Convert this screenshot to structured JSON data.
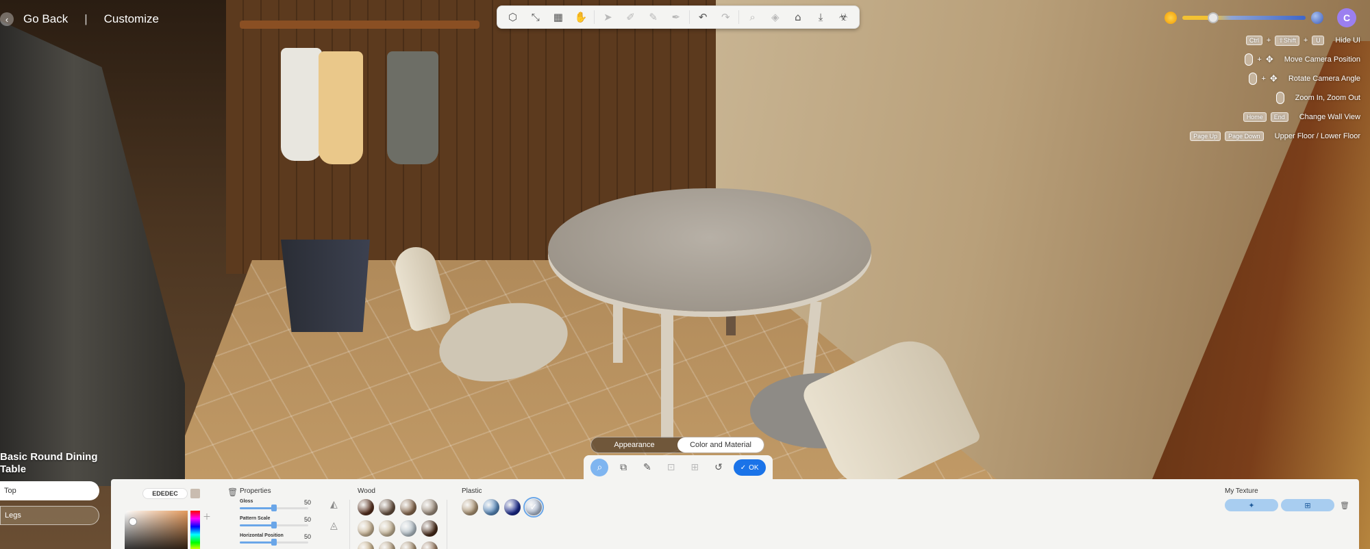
{
  "nav": {
    "back_label": "Go Back",
    "separator": "|",
    "section_label": "Customize"
  },
  "toolbar": {
    "items": [
      {
        "icon": "cube-icon",
        "glyph": "⬡",
        "enabled": true
      },
      {
        "icon": "draw-line-icon",
        "glyph": "⤡",
        "enabled": true
      },
      {
        "icon": "grid-icon",
        "glyph": "▦",
        "enabled": true
      },
      {
        "icon": "hand-icon",
        "glyph": "✋",
        "enabled": true
      },
      {
        "icon": "select-arrow-icon",
        "glyph": "➤",
        "enabled": false
      },
      {
        "icon": "edit-point-icon",
        "glyph": "✐",
        "enabled": false
      },
      {
        "icon": "pen-icon",
        "glyph": "✎",
        "enabled": false
      },
      {
        "icon": "paint-icon",
        "glyph": "✒",
        "enabled": false
      },
      {
        "icon": "undo-icon",
        "glyph": "↶",
        "enabled": true
      },
      {
        "icon": "redo-icon",
        "glyph": "↷",
        "enabled": false
      },
      {
        "icon": "search-area-icon",
        "glyph": "⌕",
        "enabled": false
      },
      {
        "icon": "layers-icon",
        "glyph": "◈",
        "enabled": false
      },
      {
        "icon": "home-icon",
        "glyph": "⌂",
        "enabled": true
      },
      {
        "icon": "download-icon",
        "glyph": "⤓",
        "enabled": true
      },
      {
        "icon": "bug-icon",
        "glyph": "☣",
        "enabled": true
      }
    ]
  },
  "daylight": {
    "level": 0.25
  },
  "user": {
    "avatar_initial": "C",
    "avatar_color": "#9b7ff0"
  },
  "shortcuts": [
    {
      "keys": [
        "Ctrl",
        "+",
        "⇧Shift",
        "+",
        "U"
      ],
      "label": "Hide UI"
    },
    {
      "keys": [
        "mouse",
        "+",
        "move"
      ],
      "label": "Move Camera Position"
    },
    {
      "keys": [
        "mouse",
        "+",
        "move"
      ],
      "label": "Rotate Camera Angle"
    },
    {
      "keys": [
        "mouse"
      ],
      "label": "Zoom In, Zoom Out"
    },
    {
      "keys": [
        "Home",
        "End"
      ],
      "label": "Change Wall View"
    },
    {
      "keys": [
        "Page Up",
        "Page Down"
      ],
      "label": "Upper Floor / Lower Floor"
    }
  ],
  "object": {
    "title": "Basic Round Dining Table",
    "parts": [
      {
        "label": "Top",
        "active": true
      },
      {
        "label": "Legs",
        "active": false
      }
    ]
  },
  "mode_tabs": [
    {
      "label": "Appearance",
      "active": false
    },
    {
      "label": "Color and Material",
      "active": true
    }
  ],
  "edit_tools": {
    "ok_label": "OK"
  },
  "color": {
    "hex": "EDEDEC",
    "swatch": "#c9bcb0"
  },
  "properties": {
    "title": "Properties",
    "items": [
      {
        "label": "Gloss",
        "value": 50
      },
      {
        "label": "Pattern Scale",
        "value": 50
      },
      {
        "label": "Horizontal Position",
        "value": 50
      }
    ]
  },
  "materials": {
    "wood": {
      "title": "Wood",
      "swatches": [
        "#5a3220",
        "#6b5443",
        "#8c6d52",
        "#a09080",
        "#cdb898",
        "#c9b89a",
        "#b8c4cc",
        "#4a2c1a",
        "#c8b088",
        "#b6a080",
        "#a89070",
        "#9a7a60"
      ]
    },
    "plastic": {
      "title": "Plastic",
      "swatches": [
        "#b09878",
        "#5a8cc0",
        "#1a2a90",
        "#b8c4d8"
      ],
      "selected_index": 3
    }
  },
  "my_texture": {
    "title": "My Texture"
  }
}
